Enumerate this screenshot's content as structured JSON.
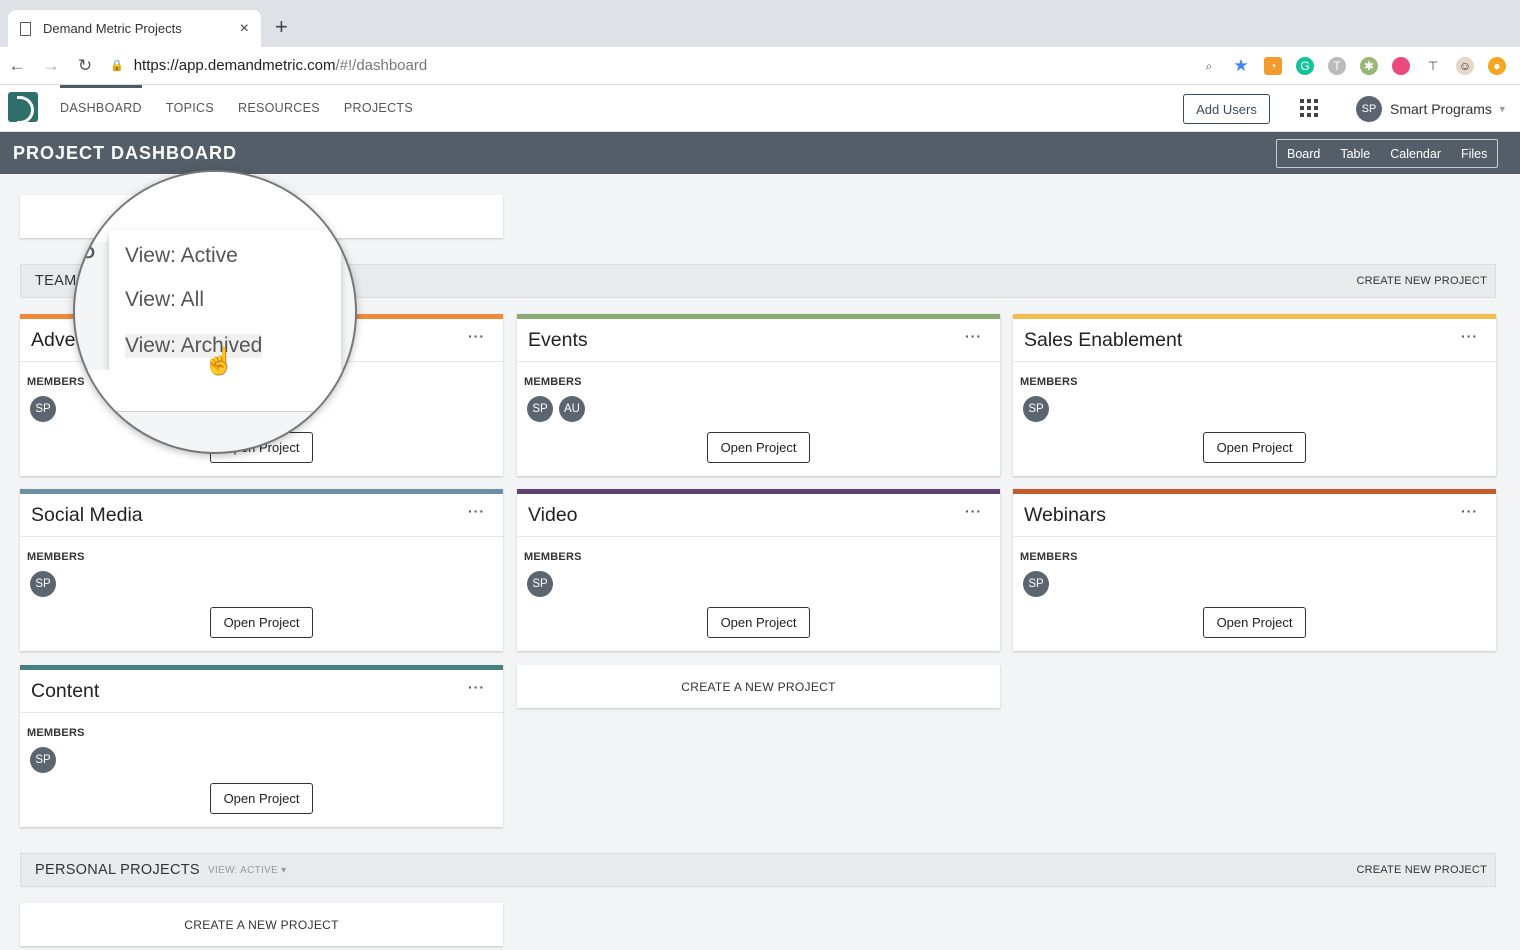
{
  "browser": {
    "tab_title": "Demand Metric Projects",
    "tab_close": "×",
    "new_tab": "+",
    "url_host": "https://app.demandmetric.com",
    "url_path": "/#!/dashboard"
  },
  "nav": {
    "items": [
      {
        "label": "DASHBOARD",
        "active": true
      },
      {
        "label": "TOPICS",
        "active": false
      },
      {
        "label": "RESOURCES",
        "active": false
      },
      {
        "label": "PROJECTS",
        "active": false
      }
    ],
    "add_users": "Add Users",
    "user_initials": "SP",
    "user_name": "Smart Programs"
  },
  "page": {
    "title": "PROJECT DASHBOARD",
    "views": [
      "Board",
      "Table",
      "Calendar",
      "Files"
    ]
  },
  "team": {
    "label": "TEAM",
    "create": "CREATE NEW PROJECT"
  },
  "projects": [
    {
      "title": "Adve",
      "color": "#ef8a3b",
      "members": [
        "SP"
      ]
    },
    {
      "title": "Events",
      "color": "#8bab72",
      "members": [
        "SP",
        "AU"
      ]
    },
    {
      "title": "Sales Enablement",
      "color": "#f2bd4f",
      "members": [
        "SP"
      ]
    },
    {
      "title": "Social Media",
      "color": "#6b8fa3",
      "members": [
        "SP"
      ]
    },
    {
      "title": "Video",
      "color": "#5d4470",
      "members": [
        "SP"
      ]
    },
    {
      "title": "Webinars",
      "color": "#c55a2e",
      "members": [
        "SP"
      ]
    },
    {
      "title": "Content",
      "color": "#46807f",
      "members": [
        "SP"
      ]
    }
  ],
  "card_labels": {
    "members": "MEMBERS",
    "open": "Open Project",
    "more": "···"
  },
  "create_new_card": "CREATE A NEW PROJECT",
  "personal": {
    "label": "PERSONAL PROJECTS",
    "view": "VIEW: ACTIVE ▾",
    "create": "CREATE NEW PROJECT",
    "create_card": "CREATE A NEW PROJECT"
  },
  "dropdown": {
    "items": [
      "View: Active",
      "View: All",
      "View: Archived"
    ],
    "hovered": "View: Archived"
  }
}
